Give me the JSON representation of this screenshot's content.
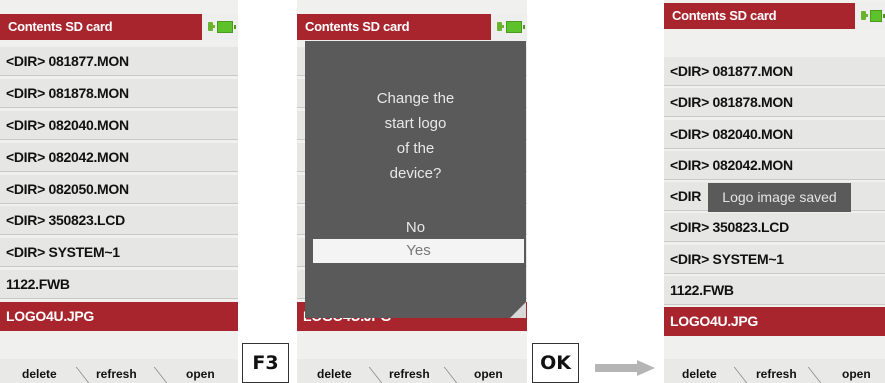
{
  "screens": [
    {
      "title": "Contents SD card",
      "items": [
        "<DIR> 081877.MON",
        "<DIR> 081878.MON",
        "<DIR> 082040.MON",
        "<DIR> 082042.MON",
        "<DIR> 082050.MON",
        "<DIR> 350823.LCD",
        "<DIR> SYSTEM~1",
        "1122.FWB",
        "LOGO4U.JPG"
      ],
      "selected_index": 8,
      "footer": [
        "delete",
        "refresh",
        "open"
      ]
    },
    {
      "title": "Contents SD card",
      "selected_item": "LOGO4U.JPG",
      "dialog": {
        "question": "Change the\nstart logo\nof the\ndevice?",
        "no_label": "No",
        "yes_label": "Yes",
        "highlighted": "Yes"
      },
      "footer": [
        "delete",
        "refresh",
        "open"
      ]
    },
    {
      "title": "Contents SD card",
      "items": [
        "<DIR> 081877.MON",
        "<DIR> 081878.MON",
        "<DIR> 082040.MON",
        "<DIR> 082042.MON",
        "<DIR",
        "<DIR> 350823.LCD",
        "<DIR> SYSTEM~1",
        "1122.FWB",
        "LOGO4U.JPG"
      ],
      "selected_index": 8,
      "toast": "Logo image saved",
      "footer": [
        "delete",
        "refresh",
        "open"
      ]
    }
  ],
  "keys": {
    "first": "F3",
    "second": "OK"
  },
  "colors": {
    "accent": "#a8252e",
    "battery": "#5dc22a",
    "dialog": "#5a5a5a",
    "arrow": "#b5b5b5"
  },
  "icons": {
    "plug": "power-plug-icon",
    "battery": "battery-icon",
    "arrow": "arrow-right-icon"
  }
}
